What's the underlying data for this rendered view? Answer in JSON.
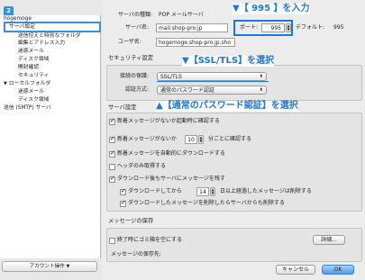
{
  "badge": "2",
  "sidebar": {
    "items": [
      {
        "label": "hogemoge",
        "indent": 0
      },
      {
        "label": "サーバ設定",
        "indent": 1
      },
      {
        "label": "送信控えと特別なフォルダ",
        "indent": 1
      },
      {
        "label": "編集とアドレス入力",
        "indent": 1
      },
      {
        "label": "迷惑メール",
        "indent": 1
      },
      {
        "label": "ディスク領域",
        "indent": 1
      },
      {
        "label": "開封確認",
        "indent": 1
      },
      {
        "label": "セキュリティ",
        "indent": 1
      },
      {
        "label": "ローカルフォルダ",
        "indent": 0
      },
      {
        "label": "迷惑メール",
        "indent": 1
      },
      {
        "label": "ディスク領域",
        "indent": 1
      },
      {
        "label": "送信 (SMTP) サーバ",
        "indent": 0
      }
    ],
    "disclosure": "▼",
    "account_button": "アカウント操作",
    "account_arrow": "▼"
  },
  "server": {
    "type_label": "サーバの種類:",
    "type_value": "POP メールサーバ",
    "name_label": "サーバ名:",
    "name_value": "mail.shop-pro.jp",
    "port_label": "ポート:",
    "port_value": "995",
    "default_label": "デフォルト:",
    "default_value": "995",
    "user_label": "ユーザ名:",
    "user_value": "hogemoge.shop-pro.jp.sho"
  },
  "security": {
    "title": "セキュリティ設定",
    "protection_label": "接続の保護:",
    "protection_value": "SSL/TLS",
    "auth_label": "認証方式:",
    "auth_value": "通常のパスワード認証"
  },
  "server_settings": {
    "title": "サーバ設定",
    "startup_check": "新着メッセージがないか起動時に確認する",
    "interval_check_pre": "新着メッセージがないか",
    "interval_value": "10",
    "interval_check_post": "分ごとに確認する",
    "auto_download": "新着メッセージを自動的にダウンロードする",
    "headers_only": "ヘッダのみ取得する",
    "leave_on_server": "ダウンロード後もサーバにメッセージを残す",
    "delete_after_pre": "ダウンロードしてから",
    "delete_after_value": "14",
    "delete_after_post": "日以上経過したメッセージは削除する",
    "delete_when_deleted": "ダウンロードしたメッセージを削除したらサーバからも削除する"
  },
  "message_storage": {
    "title": "メッセージの保存",
    "empty_trash": "終了時にゴミ箱を空にする",
    "details_button": "詳細...",
    "store_label": "メッセージの保存先:"
  },
  "buttons": {
    "cancel": "キャンセル",
    "ok": "OK"
  },
  "annotations": {
    "port": "▼【 995 】を入力",
    "ssl": "▼【SSL/TLS】を選択",
    "auth": "▲【通常のパスワード認証】を選択"
  },
  "colors": {
    "accent": "#1a78e0",
    "sidebar_selection": "#3b8ed8"
  }
}
